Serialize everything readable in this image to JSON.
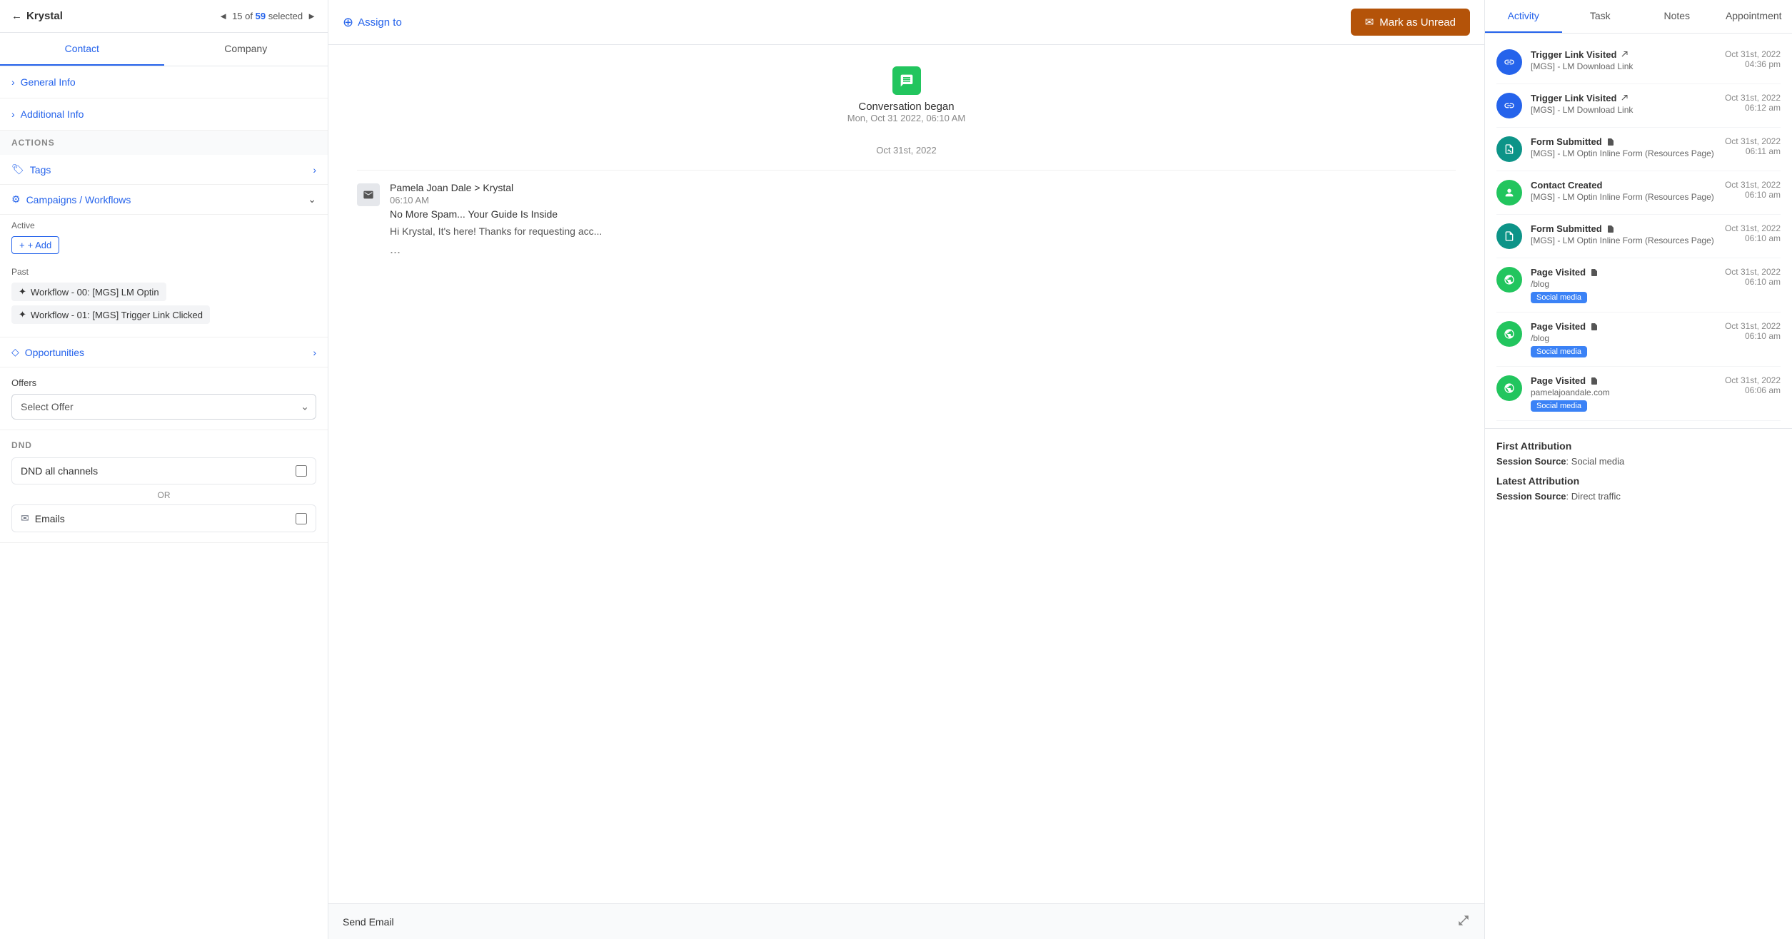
{
  "leftPanel": {
    "backLabel": "Krystal",
    "counter": "15 of",
    "total": "59",
    "selectedLabel": "selected",
    "tabs": [
      {
        "label": "Contact",
        "active": true
      },
      {
        "label": "Company",
        "active": false
      }
    ],
    "sections": {
      "generalInfo": "General Info",
      "additionalInfo": "Additional Info",
      "actionsLabel": "ACTIONS",
      "tags": "Tags",
      "campaignsWorkflows": "Campaigns / Workflows",
      "activeLabel": "Active",
      "addBtn": "+ Add",
      "pastLabel": "Past",
      "workflows": [
        "Workflow - 00: [MGS] LM Optin",
        "Workflow - 01: [MGS] Trigger Link Clicked"
      ],
      "opportunities": "Opportunities"
    },
    "offers": {
      "label": "Offers",
      "placeholder": "Select Offer",
      "options": [
        "Select Offer"
      ]
    },
    "dnd": {
      "label": "DND",
      "allChannels": "DND all channels",
      "orLabel": "OR",
      "emails": "Emails"
    }
  },
  "middlePanel": {
    "assignTo": "Assign to",
    "markUnread": "Mark as Unread",
    "conversation": {
      "began": "Conversation began",
      "beganDate": "Mon, Oct 31 2022, 06:10 AM",
      "dateDivider": "Oct 31st, 2022",
      "email": {
        "from": "Pamela Joan Dale > Krystal",
        "time": "06:10 AM",
        "subject": "No More Spam... Your Guide Is Inside",
        "preview": "Hi Krystal, It's here! Thanks for requesting acc...",
        "dots": "..."
      }
    },
    "sendBar": {
      "label": "Send Email"
    }
  },
  "rightPanel": {
    "tabs": [
      {
        "label": "Activity",
        "active": true
      },
      {
        "label": "Task",
        "active": false
      },
      {
        "label": "Notes",
        "active": false
      },
      {
        "label": "Appointment",
        "active": false
      }
    ],
    "activities": [
      {
        "icon": "link-icon",
        "iconType": "blue",
        "title": "Trigger Link Visited",
        "clipIcon": true,
        "sub": "[MGS] - LM Download Link",
        "date": "Oct 31st, 2022",
        "time": "04:36 pm"
      },
      {
        "icon": "link-icon",
        "iconType": "blue",
        "title": "Trigger Link Visited",
        "clipIcon": true,
        "sub": "[MGS] - LM Download Link",
        "date": "Oct 31st, 2022",
        "time": "06:12 am"
      },
      {
        "icon": "form-icon",
        "iconType": "teal",
        "title": "Form Submitted",
        "clipIcon": true,
        "sub": "[MGS] - LM Optin Inline Form (Resources Page)",
        "date": "Oct 31st, 2022",
        "time": "06:11 am"
      },
      {
        "icon": "contact-icon",
        "iconType": "green",
        "title": "Contact Created",
        "clipIcon": false,
        "sub": "[MGS] - LM Optin Inline Form (Resources Page)",
        "date": "Oct 31st, 2022",
        "time": "06:10 am"
      },
      {
        "icon": "form-icon",
        "iconType": "teal",
        "title": "Form Submitted",
        "clipIcon": true,
        "sub": "[MGS] - LM Optin Inline Form (Resources Page)",
        "date": "Oct 31st, 2022",
        "time": "06:10 am"
      },
      {
        "icon": "page-icon",
        "iconType": "green",
        "title": "Page Visited",
        "clipIcon": true,
        "sub": "/blog",
        "badge": "Social media",
        "date": "Oct 31st, 2022",
        "time": "06:10 am"
      },
      {
        "icon": "page-icon",
        "iconType": "green",
        "title": "Page Visited",
        "clipIcon": true,
        "sub": "/blog",
        "badge": "Social media",
        "date": "Oct 31st, 2022",
        "time": "06:10 am"
      },
      {
        "icon": "page-icon",
        "iconType": "green",
        "title": "Page Visited",
        "clipIcon": true,
        "sub": "pamelajoandale.com",
        "badge": "Social media",
        "date": "Oct 31st, 2022",
        "time": "06:06 am"
      }
    ],
    "firstAttribution": {
      "title": "First Attribution",
      "sessionSource": "Session Source",
      "value": "Social media"
    },
    "latestAttribution": {
      "title": "Latest Attribution",
      "sessionSource": "Session Source",
      "value": "Direct traffic"
    }
  },
  "icons": {
    "back": "←",
    "navPrev": "◄",
    "navNext": "►",
    "chevronRight": "›",
    "chevronDown": "⌄",
    "tag": "🏷",
    "campaign": "⚙",
    "opportunity": "◇",
    "plus": "+",
    "workflow": "✦",
    "assign": "⊕",
    "email": "✉",
    "expand": "⤢",
    "link": "↗",
    "form": "📋",
    "contact": "👤",
    "globe": "🌐"
  }
}
